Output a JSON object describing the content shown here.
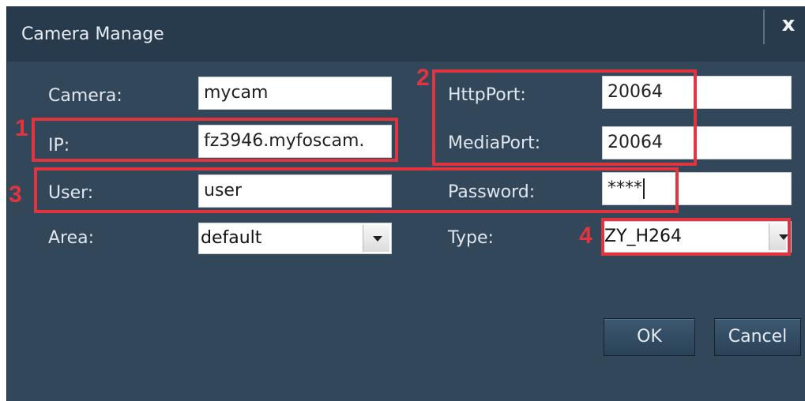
{
  "dialog": {
    "title": "Camera Manage",
    "close_label": "x"
  },
  "form": {
    "camera": {
      "label": "Camera:",
      "value": "mycam"
    },
    "ip": {
      "label": "IP:",
      "value": "fz3946.myfoscam."
    },
    "user": {
      "label": "User:",
      "value": "user"
    },
    "area": {
      "label": "Area:",
      "selected": "default"
    },
    "http_port": {
      "label": "HttpPort:",
      "value": "20064"
    },
    "media_port": {
      "label": "MediaPort:",
      "value": "20064"
    },
    "password": {
      "label": "Password:",
      "value": "****"
    },
    "type": {
      "label": "Type:",
      "selected": "ZY_H264"
    }
  },
  "buttons": {
    "ok": "OK",
    "cancel": "Cancel"
  },
  "annotations": {
    "n1": "1",
    "n2": "2",
    "n3": "3",
    "n4": "4",
    "color": "#e0343f"
  }
}
